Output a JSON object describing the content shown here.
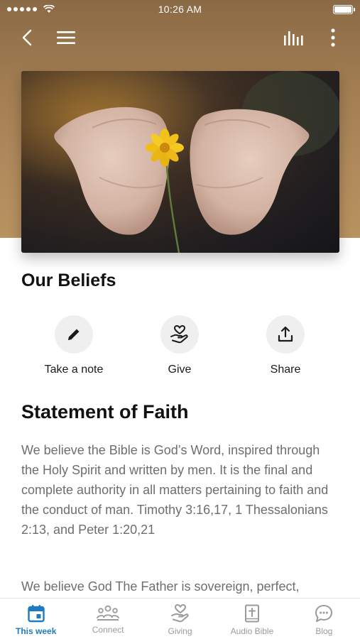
{
  "status_bar": {
    "time": "10:26 AM"
  },
  "colors": {
    "accent": "#1e7bbf",
    "hero": "#a27d52",
    "text_muted": "#6e6e6e"
  },
  "header": {
    "icons": [
      "back-icon",
      "menu-icon",
      "audio-bars-icon",
      "more-vertical-icon"
    ]
  },
  "page": {
    "title": "Our Beliefs"
  },
  "actions": [
    {
      "label": "Take a note",
      "icon": "pencil-icon"
    },
    {
      "label": "Give",
      "icon": "give-icon"
    },
    {
      "label": "Share",
      "icon": "share-icon"
    }
  ],
  "content": {
    "section_title": "Statement of Faith",
    "paragraphs": [
      "We believe the Bible is God’s Word, inspired through the Holy Spirit and written by men. It is the final and complete authority in all matters pertaining to faith and the conduct of man. Timothy 3:16,17, 1 Thessalonians 2:13, and Peter 1:20,21",
      "We believe God The Father is sovereign, perfect,"
    ]
  },
  "tabs": [
    {
      "label": "This week",
      "icon": "calendar-icon",
      "active": true
    },
    {
      "label": "Connect",
      "icon": "people-icon",
      "active": false
    },
    {
      "label": "Giving",
      "icon": "hand-heart-icon",
      "active": false
    },
    {
      "label": "Audio Bible",
      "icon": "bible-icon",
      "active": false
    },
    {
      "label": "Blog",
      "icon": "chat-bubble-icon",
      "active": false
    }
  ]
}
